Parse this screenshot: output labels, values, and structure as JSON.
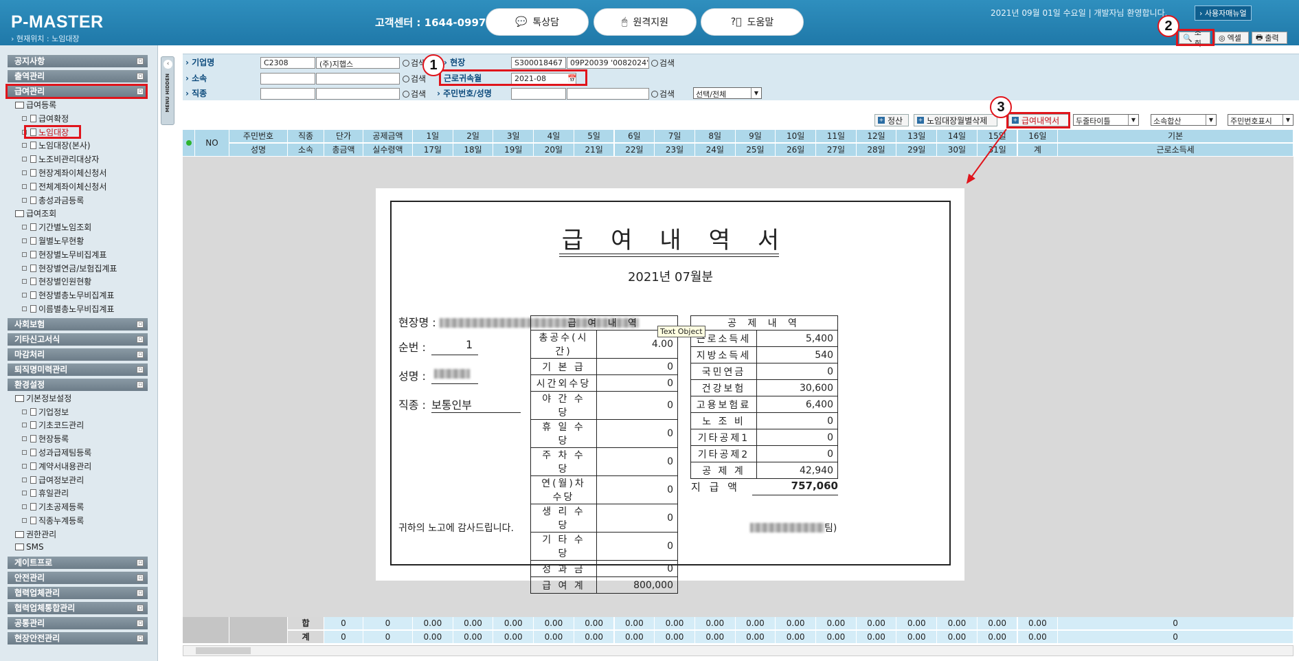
{
  "header": {
    "brand": "P-MASTER",
    "location": "› 현재위치 : 노임대장",
    "customer_center": "고객센터 : 1644-0997",
    "buttons": [
      {
        "label": "톡상담",
        "icon": "chat-icon"
      },
      {
        "label": "원격지원",
        "icon": "mouse-icon"
      },
      {
        "label": "도움말",
        "icon": "help-icon"
      }
    ],
    "greeting": "2021년 09월 01일 수요일 | 개발자님 환영합니다.",
    "manual": "› 사용자매뉴얼",
    "toolbar": {
      "search": "조회",
      "excel": "엑셀",
      "print": "출력"
    }
  },
  "sidebar": {
    "sections_top": [
      "공지사항",
      "출역관리",
      "급여관리"
    ],
    "group1": "급여등록",
    "group1_items": [
      "급여확정",
      "노임대장",
      "노임대장(본사)",
      "노조비관리대상자",
      "현장계좌이체신청서",
      "전체계좌이체신청서",
      "총성과금등록"
    ],
    "group2": "급여조회",
    "group2_items": [
      "기간별노임조회",
      "월별노무현황",
      "현장별노무비집계표",
      "현장별연금/보험집계표",
      "현장별인원현황",
      "현장별총노무비집계표",
      "이름별총노무비집계표"
    ],
    "sections_mid": [
      "사회보험",
      "기타신고서식",
      "마감처리",
      "퇴직명미력관리",
      "환경설정"
    ],
    "group3": "기본정보설정",
    "group3_items": [
      "기업정보",
      "기초코드관리",
      "현장등록",
      "성과급제팀등록",
      "계약서내용관리",
      "급여정보관리",
      "휴일관리",
      "기초공제등록",
      "직종누계등록"
    ],
    "group4": "권한관리",
    "group5": "SMS",
    "sections_bottom": [
      "게이트프로",
      "안전관리",
      "협력업체관리",
      "협력업체통합관리",
      "공통관리",
      "현장안전관리"
    ],
    "collapse_label": "MENU HIDDEN"
  },
  "search": {
    "company_label": "기업명",
    "company_code": "C2308",
    "company_name": "(주)지햅스",
    "affil_label": "소속",
    "job_label": "직종",
    "search_btn": "검색",
    "site_label": "현장",
    "site_code": "S300018467",
    "site_name": "09P20039 '0082024'",
    "month_label": "근로귀속월",
    "month_value": "2021-08",
    "resident_label": "주민번호/성명",
    "select_all": "선택/전체"
  },
  "actions": {
    "settle": "정산",
    "delete_site": "노임대장월별삭제",
    "payslip": "급여내역서",
    "select1": "두줄타이틀",
    "select2": "소속합산",
    "select3": "주민번호표시"
  },
  "grid": {
    "row1": [
      "NO",
      "주민번호",
      "직종",
      "단가",
      "공제금액",
      "1일",
      "2일",
      "3일",
      "4일",
      "5일",
      "6일",
      "7일",
      "8일",
      "9일",
      "10일",
      "11일",
      "12일",
      "13일",
      "14일",
      "15일",
      "16일",
      "기본"
    ],
    "row2": [
      "성명",
      "소속",
      "총금액",
      "실수령액",
      "17일",
      "18일",
      "19일",
      "20일",
      "21일",
      "22일",
      "23일",
      "24일",
      "25일",
      "26일",
      "27일",
      "28일",
      "29일",
      "30일",
      "31일",
      "계",
      "근로소득세"
    ],
    "footer_labels": [
      "합",
      "계"
    ],
    "footer_row": [
      "0",
      "0",
      "0.00",
      "0.00",
      "0.00",
      "0.00",
      "0.00",
      "0.00",
      "0.00",
      "0.00",
      "0.00",
      "0.00",
      "0.00",
      "0.00",
      "0.00",
      "0.00",
      "0.00",
      "0.00",
      "0"
    ]
  },
  "payslip": {
    "title": "급여내역서",
    "period": "2021년 07월분",
    "site_label": "현장명 :",
    "seq_label": "순번 :",
    "seq_value": "1",
    "name_label": "성명 :",
    "job_label": "직종 :",
    "job_value": "보통인부",
    "pay_header": "급 여 내 역",
    "pay_rows": [
      {
        "k": "총공수(시간)",
        "v": "4.00"
      },
      {
        "k": "기 본 급",
        "v": "0"
      },
      {
        "k": "시간외수당",
        "v": "0"
      },
      {
        "k": "야 간 수 당",
        "v": "0"
      },
      {
        "k": "휴 일 수 당",
        "v": "0"
      },
      {
        "k": "주 차 수 당",
        "v": "0"
      },
      {
        "k": "연(월)차 수당",
        "v": "0"
      },
      {
        "k": "생 리 수 당",
        "v": "0"
      },
      {
        "k": "기 타 수 당",
        "v": "0"
      },
      {
        "k": "성 과 금",
        "v": "0"
      },
      {
        "k": "급 여 계",
        "v": "800,000"
      }
    ],
    "ded_header": "공 제 내 역",
    "ded_rows": [
      {
        "k": "근로소득세",
        "v": "5,400"
      },
      {
        "k": "지방소득세",
        "v": "540"
      },
      {
        "k": "국민연금",
        "v": "0"
      },
      {
        "k": "건강보험",
        "v": "30,600"
      },
      {
        "k": "고용보험료",
        "v": "6,400"
      },
      {
        "k": "노 조 비",
        "v": "0"
      },
      {
        "k": "기타공제1",
        "v": "0"
      },
      {
        "k": "기타공제2",
        "v": "0"
      },
      {
        "k": "공 제 계",
        "v": "42,940"
      }
    ],
    "net_label": "지 급 액",
    "net_value": "757,060",
    "thanks": "귀하의 노고에 감사드립니다.",
    "team_suffix": "팀)",
    "tooltip": "Text Object"
  },
  "markers": [
    "1",
    "2",
    "3"
  ],
  "colors": {
    "header": "#2184b4",
    "highlight": "#e0141b",
    "grid_header": "#aed8ea"
  }
}
